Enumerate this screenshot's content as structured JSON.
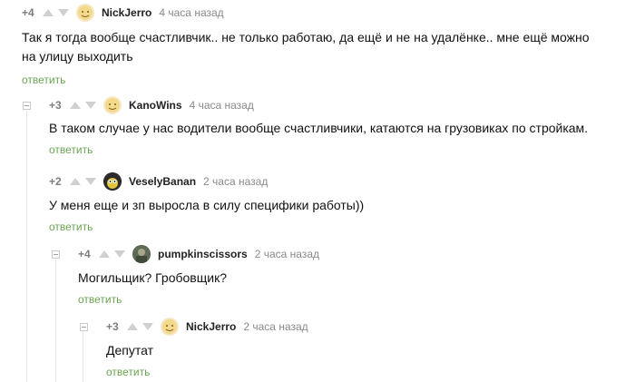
{
  "comments": [
    {
      "rating": "+4",
      "author": "NickJerro",
      "time": "4 часа назад",
      "text_lines": [
        "Так я тогда вообще счастливчик.. не только работаю, да ещё и не на удалёнке.. мне ещё можно",
        "на улицу выходить"
      ],
      "reply": "ответить",
      "avatar_icon": "smiley-avatar-icon"
    },
    {
      "rating": "+3",
      "author": "KanoWins",
      "time": "4 часа назад",
      "text_lines": [
        "В таком случае у нас водители вообще счастливчики, катаются на грузовиках по стройкам."
      ],
      "reply": "ответить",
      "avatar_icon": "smiley-avatar-icon"
    },
    {
      "rating": "+2",
      "author": "VeselyBanan",
      "time": "2 часа назад",
      "text_lines": [
        "У меня еще и зп выросла в силу специфики работы))"
      ],
      "reply": "ответить",
      "avatar_icon": "cartoon-avatar-icon"
    },
    {
      "rating": "+4",
      "author": "pumpkinscissors",
      "time": "2 часа назад",
      "text_lines": [
        "Могильщик? Гробовщик?"
      ],
      "reply": "ответить",
      "avatar_icon": "photo-avatar-icon"
    },
    {
      "rating": "+3",
      "author": "NickJerro",
      "time": "2 часа назад",
      "text_lines": [
        "Депутат"
      ],
      "reply": "ответить",
      "avatar_icon": "smiley-avatar-icon"
    }
  ],
  "colors": {
    "reply_link": "#6ba553",
    "time": "#8a8a8a",
    "arrows": "#d0d0d0"
  }
}
